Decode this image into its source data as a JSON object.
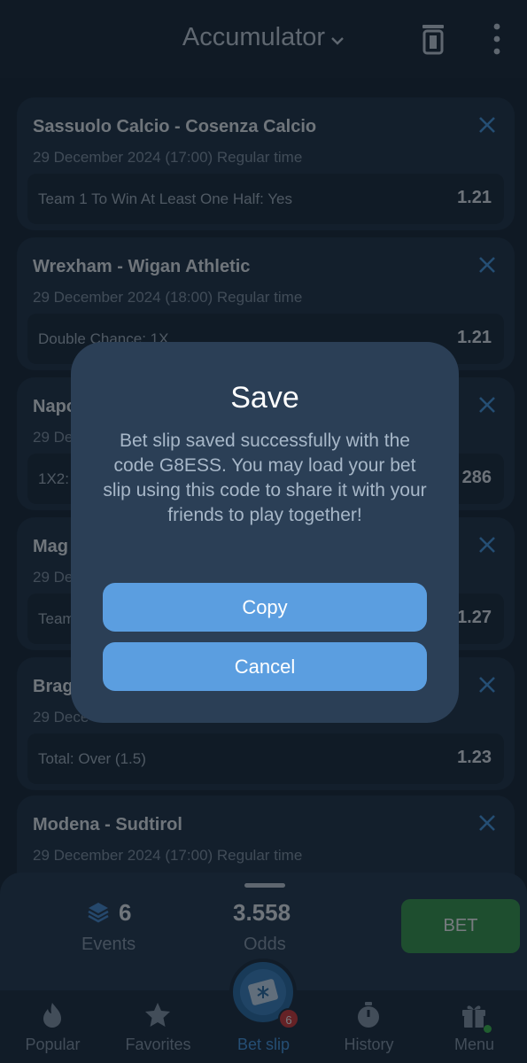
{
  "header": {
    "title": "Accumulator"
  },
  "bets": [
    {
      "match": "Sassuolo Calcio - Cosenza Calcio",
      "date": "29 December 2024 (17:00) Regular time",
      "market": "Team 1 To Win At Least One Half: Yes",
      "odd": "1.21"
    },
    {
      "match": "Wrexham - Wigan Athletic",
      "date": "29 December 2024 (18:00) Regular time",
      "market": "Double Chance: 1X",
      "odd": "1.21"
    },
    {
      "match": "Napo",
      "date": "29 De",
      "market": "1X2:",
      "odd": "286"
    },
    {
      "match": "Mag",
      "date": "29 De",
      "market": "Team",
      "odd": "1.27"
    },
    {
      "match": "Brag",
      "date": "29 Dece",
      "market": "Total: Over (1.5)",
      "odd": "1.23"
    },
    {
      "match": "Modena - Sudtirol",
      "date": "29 December 2024 (17:00) Regular time",
      "market": "",
      "odd": ""
    }
  ],
  "summary": {
    "events_count": "6",
    "events_label": "Events",
    "odds_total": "3.558",
    "odds_label": "Odds",
    "bet_label": "BET"
  },
  "nav": {
    "items": [
      {
        "label": "Popular",
        "icon": "fire-icon"
      },
      {
        "label": "Favorites",
        "icon": "star-icon"
      },
      {
        "label": "Bet slip",
        "icon": "ticket-icon"
      },
      {
        "label": "History",
        "icon": "stopwatch-icon"
      },
      {
        "label": "Menu",
        "icon": "gift-icon"
      }
    ],
    "bet_slip_badge": "6",
    "active": "Bet slip"
  },
  "modal": {
    "title": "Save",
    "message": "Bet slip saved successfully with the code G8ESS. You may load your bet slip using this code to share it with your friends to play together!",
    "copy_label": "Copy",
    "cancel_label": "Cancel"
  },
  "colors": {
    "accent": "#4a9be6",
    "bet_green": "#3b9b4e",
    "badge_red": "#d73b3b",
    "modal_button": "#5b9ee0"
  }
}
